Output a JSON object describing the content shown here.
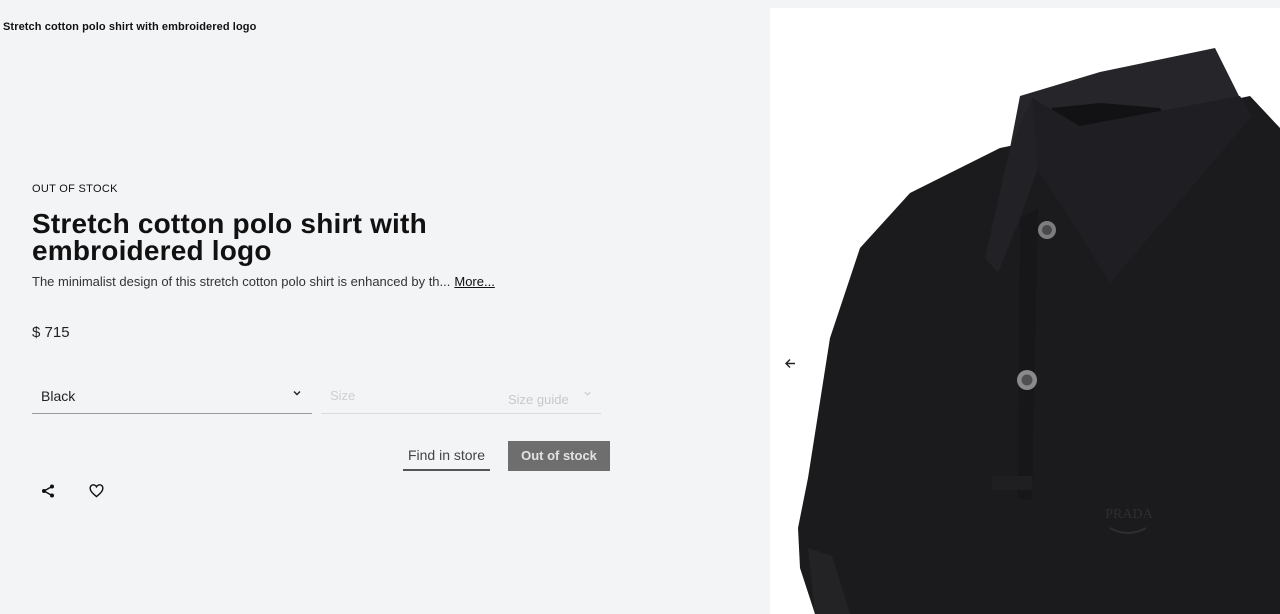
{
  "page": {
    "heading": "Stretch cotton polo shirt with embroidered logo"
  },
  "product": {
    "stock_status": "OUT OF STOCK",
    "title": "Stretch cotton polo shirt with embroidered logo",
    "description": "The minimalist design of this stretch cotton polo shirt is enhanced by th...",
    "more_label": "More...",
    "price": "$ 715",
    "image_logo_text": "PRADA"
  },
  "options": {
    "color": {
      "selected": "Black"
    },
    "size": {
      "placeholder": "Size",
      "guide_label": "Size guide"
    }
  },
  "actions": {
    "find_in_store": "Find in store",
    "out_of_stock": "Out of stock"
  },
  "icons": {
    "share": "share-icon",
    "wishlist": "heart-icon",
    "color_dropdown": "chevron-down-icon",
    "size_dropdown": "chevron-down-icon",
    "gallery_prev": "arrow-left-icon"
  },
  "colors": {
    "page_background": "#f3f4f6",
    "gallery_background": "#ffffff",
    "disabled_button": "#6e6e6e",
    "shirt": "#1b1b1e"
  }
}
